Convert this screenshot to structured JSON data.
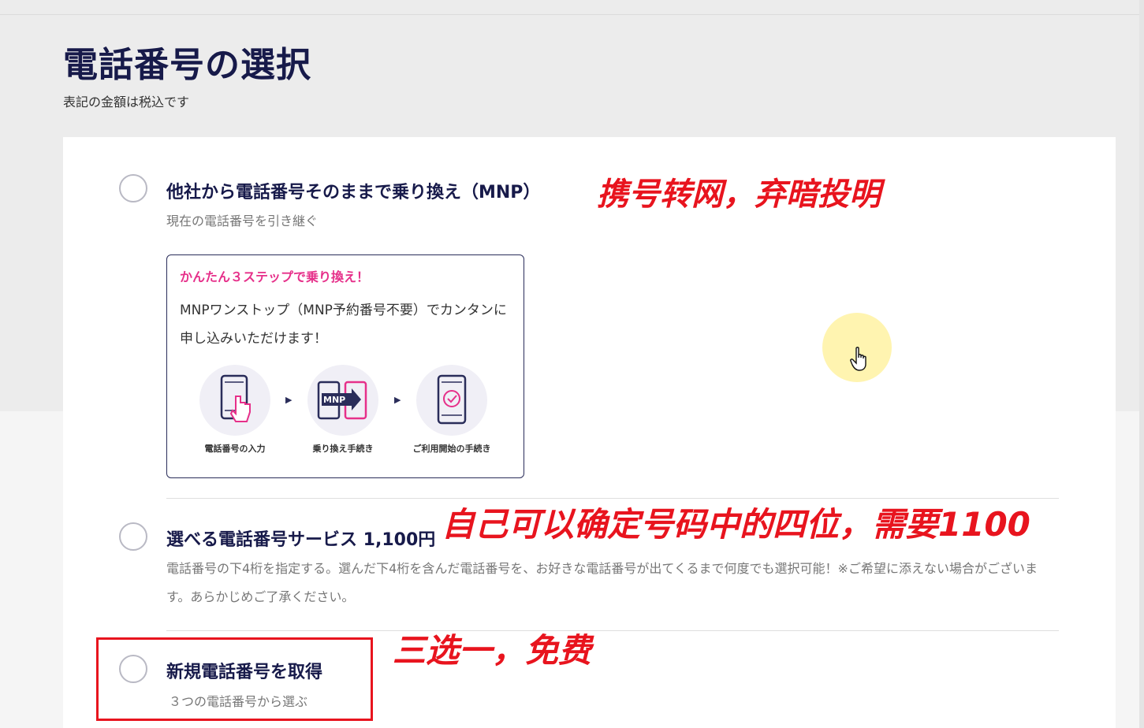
{
  "header": {
    "title": "電話番号の選択",
    "subtitle": "表記の金額は税込です"
  },
  "options": {
    "mnp": {
      "title": "他社から電話番号そのままで乗り換え（MNP）",
      "desc": "現在の電話番号を引き継ぐ",
      "box": {
        "heading": "かんたん３ステップで乗り換え！",
        "text": "MNPワンストップ（MNP予約番号不要）でカンタンに申し込みいただけます！",
        "steps": [
          "電話番号の入力",
          "乗り換え手続き",
          "ご利用開始の手続き"
        ],
        "mnp_badge": "MNP"
      }
    },
    "select": {
      "title": "選べる電話番号サービス 1,100円",
      "desc": "電話番号の下4桁を指定する。選んだ下4桁を含んだ電話番号を、お好きな電話番号が出てくるまで何度でも選択可能！※ご希望に添えない場合がございます。あらかじめご了承ください。"
    },
    "new": {
      "title": "新規電話番号を取得",
      "desc": "３つの電話番号から選ぶ"
    }
  },
  "annotations": {
    "mnp_note": "携号转网，弃暗投明",
    "select_note": "自己可以确定号码中的四位，需要1100",
    "new_note": "三选一，免费"
  },
  "colors": {
    "navy": "#171a4a",
    "pink": "#e6308a",
    "annotation_red": "#e8141e",
    "cursor_highlight": "#fff096"
  },
  "icons": [
    "phone-tap-icon",
    "mnp-transfer-icon",
    "phone-check-icon",
    "hand-cursor-icon"
  ]
}
